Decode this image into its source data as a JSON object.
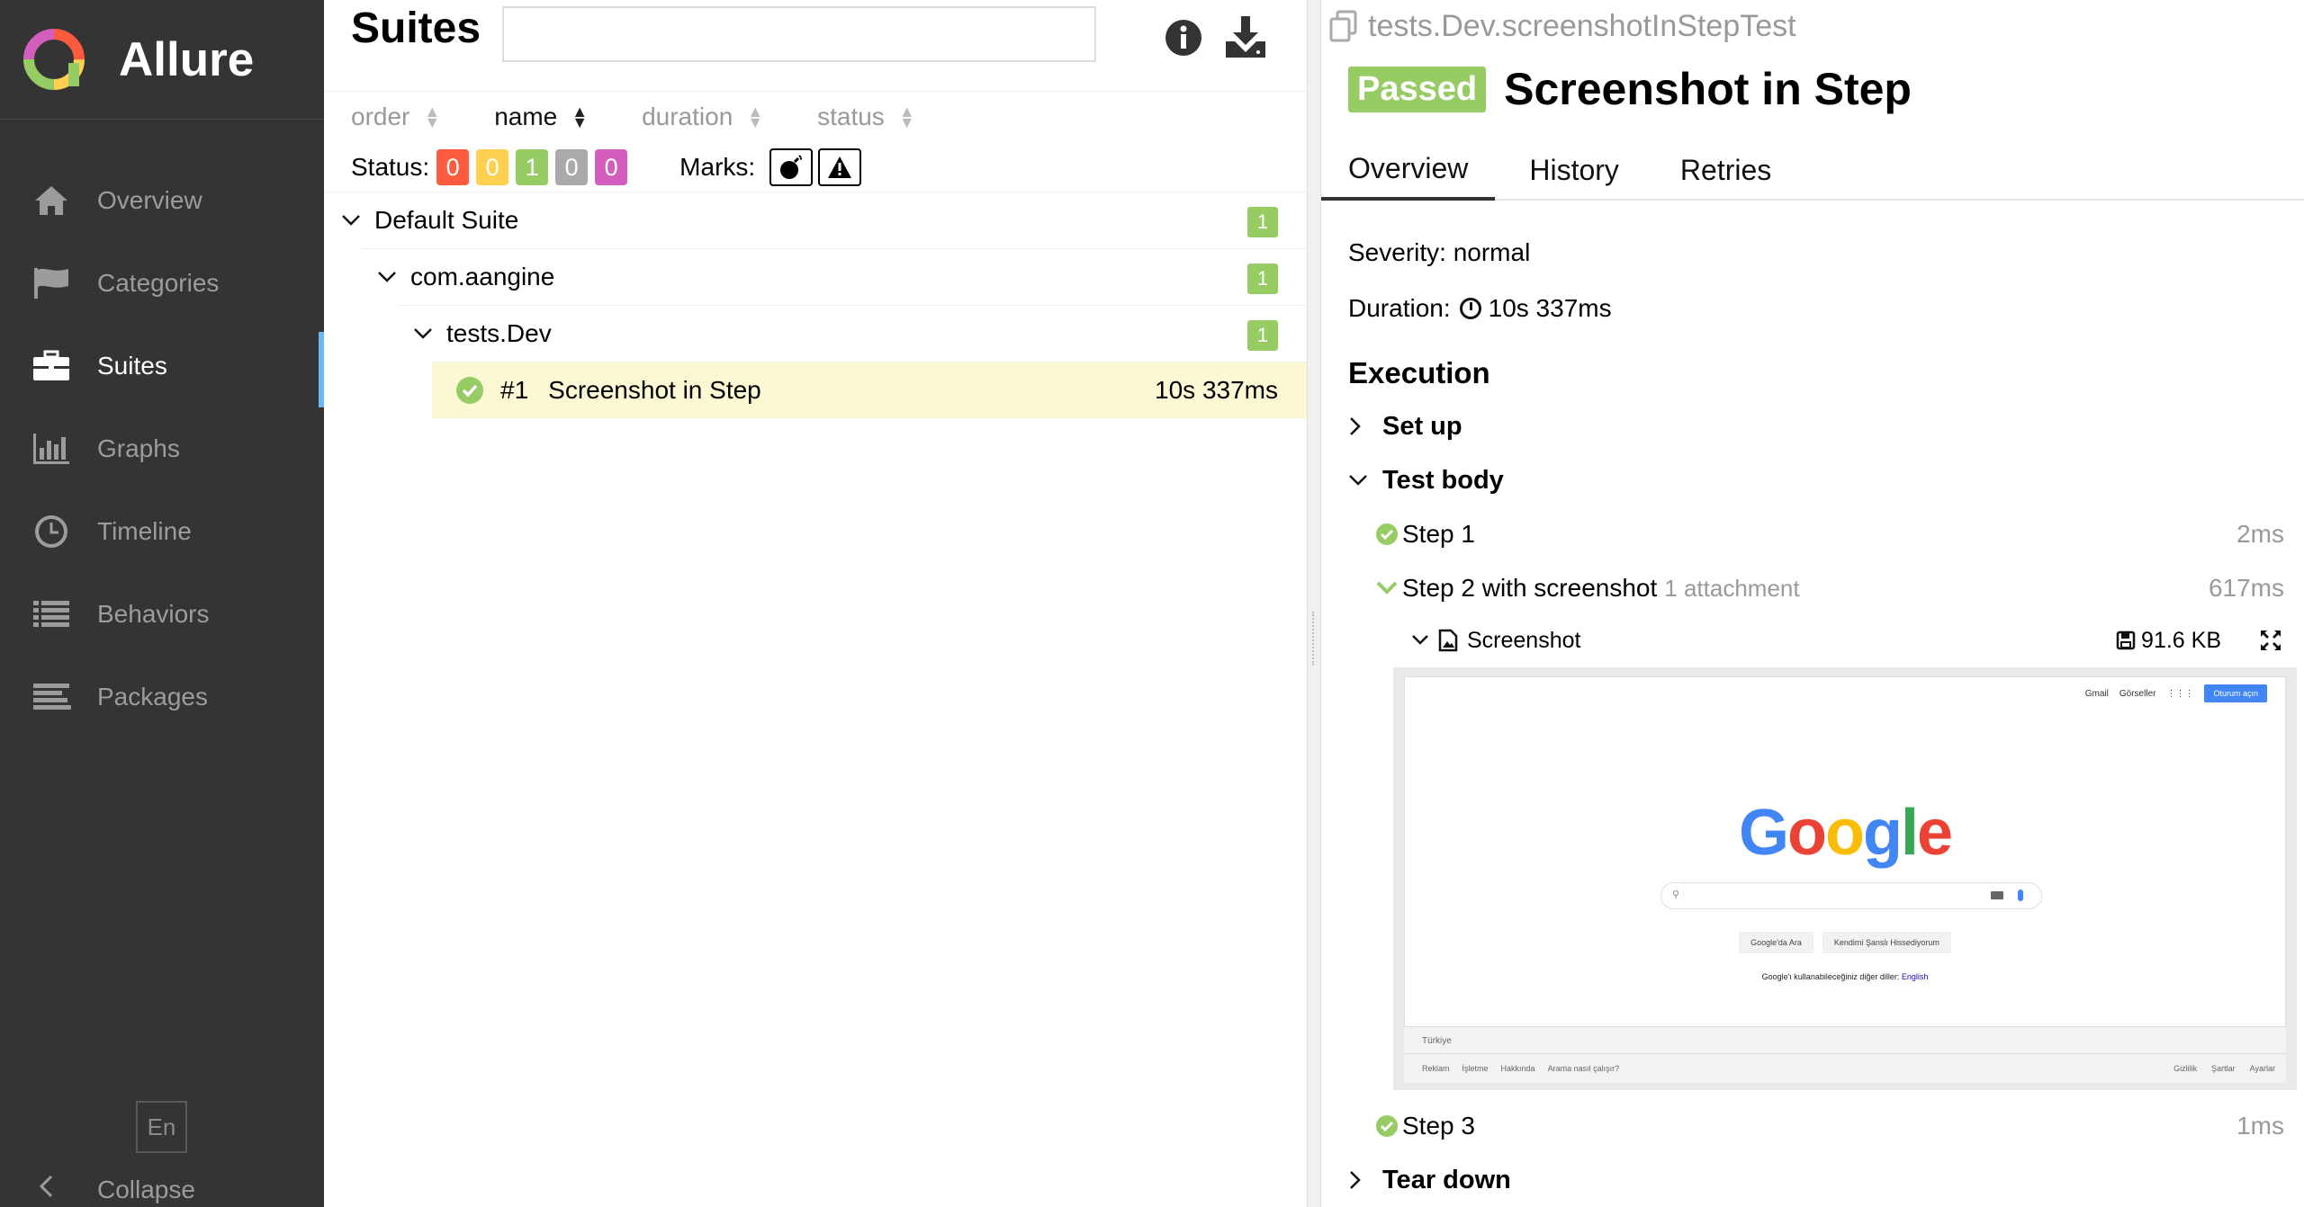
{
  "sidebar": {
    "brand": "Allure",
    "items": [
      {
        "label": "Overview",
        "icon": "home-icon"
      },
      {
        "label": "Categories",
        "icon": "flag-icon"
      },
      {
        "label": "Suites",
        "icon": "briefcase-icon",
        "active": true
      },
      {
        "label": "Graphs",
        "icon": "bar-chart-icon"
      },
      {
        "label": "Timeline",
        "icon": "clock-icon"
      },
      {
        "label": "Behaviors",
        "icon": "list-icon"
      },
      {
        "label": "Packages",
        "icon": "align-left-icon"
      }
    ],
    "language": "En",
    "collapse_label": "Collapse"
  },
  "suites": {
    "title": "Suites",
    "search_placeholder": "",
    "sort": {
      "order": "order",
      "name": "name",
      "duration": "duration",
      "status": "status",
      "active": "name"
    },
    "status_label": "Status:",
    "status_counts": [
      {
        "value": "0",
        "color": "#fd5a3e",
        "status": "failed"
      },
      {
        "value": "0",
        "color": "#ffd050",
        "status": "broken"
      },
      {
        "value": "1",
        "color": "#97cc64",
        "status": "passed"
      },
      {
        "value": "0",
        "color": "#aaaaaa",
        "status": "skipped"
      },
      {
        "value": "0",
        "color": "#d35ebe",
        "status": "unknown"
      }
    ],
    "marks_label": "Marks:",
    "tree": {
      "suite": {
        "name": "Default Suite",
        "count": "1"
      },
      "package": {
        "name": "com.aangine",
        "count": "1"
      },
      "class": {
        "name": "tests.Dev",
        "count": "1"
      },
      "test": {
        "num": "#1",
        "name": "Screenshot in Step",
        "duration": "10s 337ms"
      }
    }
  },
  "testcase": {
    "full_name": "tests.Dev.screenshotInStepTest",
    "status": "Passed",
    "status_color": "#97cc64",
    "title": "Screenshot in Step",
    "tabs": [
      "Overview",
      "History",
      "Retries"
    ],
    "severity_text": "Severity: normal",
    "duration_label": "Duration:",
    "duration_value": "10s 337ms",
    "execution_title": "Execution",
    "setup_label": "Set up",
    "body_label": "Test body",
    "steps": [
      {
        "name": "Step 1",
        "duration": "2ms"
      },
      {
        "name": "Step 2 with screenshot",
        "attachments": "1 attachment",
        "duration": "617ms"
      },
      {
        "name": "Step 3",
        "duration": "1ms"
      }
    ],
    "attachment": {
      "name": "Screenshot",
      "size": "91.6 KB"
    },
    "teardown_label": "Tear down"
  },
  "screenshot": {
    "top_links": [
      "Gmail",
      "Görseller"
    ],
    "signin": "Oturum açın",
    "logo": "Google",
    "buttons": [
      "Google'da Ara",
      "Kendimi Şanslı Hissediyorum"
    ],
    "lang_text": "Google'ı kullanabileceğiniz diğer diller:",
    "lang_link": "English",
    "country": "Türkiye",
    "footer_left": [
      "Reklam",
      "İşletme",
      "Hakkında",
      "Arama nasıl çalışır?"
    ],
    "footer_right": [
      "Gizlilik",
      "Şartlar",
      "Ayarlar"
    ]
  }
}
